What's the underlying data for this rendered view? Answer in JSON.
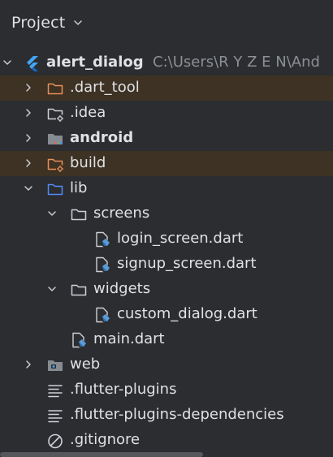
{
  "panel": {
    "title": "Project",
    "title_icon": "chevron-down-icon"
  },
  "tree": [
    {
      "label": "alert_dialog",
      "path": "C:\\Users\\R Y Z E N\\And",
      "icon": "flutter-icon",
      "expanded": true,
      "bold": true
    },
    {
      "label": ".dart_tool",
      "icon": "folder-excluded-icon",
      "expanded": false,
      "excluded": true
    },
    {
      "label": ".idea",
      "icon": "folder-config-icon",
      "expanded": false
    },
    {
      "label": "android",
      "icon": "folder-android-icon",
      "expanded": false,
      "bold": true
    },
    {
      "label": "build",
      "icon": "folder-build-icon",
      "expanded": false,
      "excluded": true
    },
    {
      "label": "lib",
      "icon": "folder-source-icon",
      "expanded": true
    },
    {
      "label": "screens",
      "icon": "folder-icon",
      "expanded": true
    },
    {
      "label": "login_screen.dart",
      "icon": "dart-file-icon"
    },
    {
      "label": "signup_screen.dart",
      "icon": "dart-file-icon"
    },
    {
      "label": "widgets",
      "icon": "folder-icon",
      "expanded": true
    },
    {
      "label": "custom_dialog.dart",
      "icon": "dart-file-icon"
    },
    {
      "label": "main.dart",
      "icon": "dart-file-icon"
    },
    {
      "label": "web",
      "icon": "folder-web-icon",
      "expanded": false
    },
    {
      "label": ".flutter-plugins",
      "icon": "text-file-icon"
    },
    {
      "label": ".flutter-plugins-dependencies",
      "icon": "text-file-icon"
    },
    {
      "label": ".gitignore",
      "icon": "ignore-file-icon"
    }
  ],
  "colors": {
    "background": "#2b2d30",
    "excluded_row": "#3d3223",
    "text": "#dfe1e5",
    "path_text": "#8c8f94",
    "source_folder": "#548af7",
    "excluded_folder": "#e88f5b",
    "flutter_blue": "#42a5f5"
  }
}
